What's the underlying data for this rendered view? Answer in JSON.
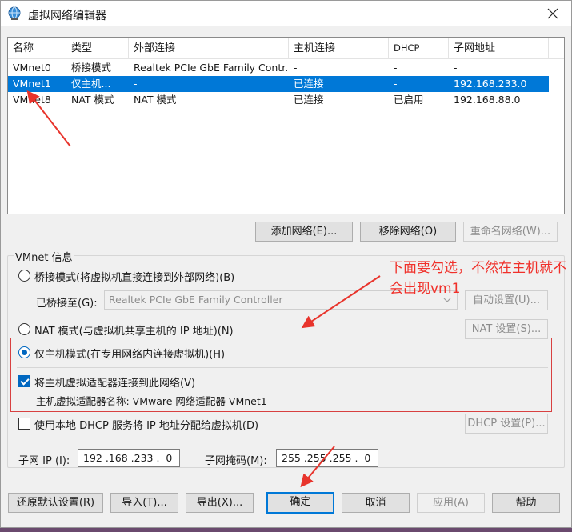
{
  "window": {
    "title": "虚拟网络编辑器"
  },
  "table": {
    "headers": [
      "名称",
      "类型",
      "外部连接",
      "主机连接",
      "DHCP",
      "子网地址"
    ],
    "rows": [
      [
        "VMnet0",
        "桥接模式",
        "Realtek PCIe GbE Family Contr...",
        "-",
        "-",
        "-"
      ],
      [
        "VMnet1",
        "仅主机...",
        "-",
        "已连接",
        "-",
        "192.168.233.0"
      ],
      [
        "VMnet8",
        "NAT 模式",
        "NAT 模式",
        "已连接",
        "已启用",
        "192.168.88.0"
      ]
    ],
    "selected_row": 1
  },
  "list_buttons": {
    "add": "添加网络(E)...",
    "remove": "移除网络(O)",
    "rename": "重命名网络(W)..."
  },
  "vmnet_info": {
    "group_title": "VMnet 信息",
    "bridged_label": "桥接模式(将虚拟机直接连接到外部网络)(B)",
    "bridged_to_label": "已桥接至(G):",
    "bridged_to_value": "Realtek PCIe GbE Family Controller",
    "auto_settings": "自动设置(U)...",
    "nat_label": "NAT 模式(与虚拟机共享主机的 IP 地址)(N)",
    "nat_settings": "NAT 设置(S)...",
    "hostonly_label": "仅主机模式(在专用网络内连接虚拟机)(H)",
    "connect_adapter_label": "将主机虚拟适配器连接到此网络(V)",
    "adapter_name_label": "主机虚拟适配器名称: VMware 网络适配器 VMnet1",
    "dhcp_label": "使用本地 DHCP 服务将 IP 地址分配给虚拟机(D)",
    "dhcp_settings": "DHCP 设置(P)...",
    "subnet_ip_label": "子网 IP (I):",
    "subnet_ip_value": "192 .168 .233 .  0",
    "subnet_mask_label": "子网掩码(M):",
    "subnet_mask_value": "255 .255 .255 .  0",
    "selected_mode": "hostonly",
    "connect_adapter_checked": true,
    "dhcp_checked": false
  },
  "bottom_buttons": {
    "restore": "还原默认设置(R)",
    "import": "导入(T)...",
    "export": "导出(X)...",
    "ok": "确定",
    "cancel": "取消",
    "apply": "应用(A)",
    "help": "帮助"
  },
  "annotation": {
    "text": "下面要勾选，不然在主机就不会出现vm1",
    "color": "#f0302a"
  },
  "colors": {
    "selection": "#0078d7",
    "annotation_red": "#f0302a"
  }
}
